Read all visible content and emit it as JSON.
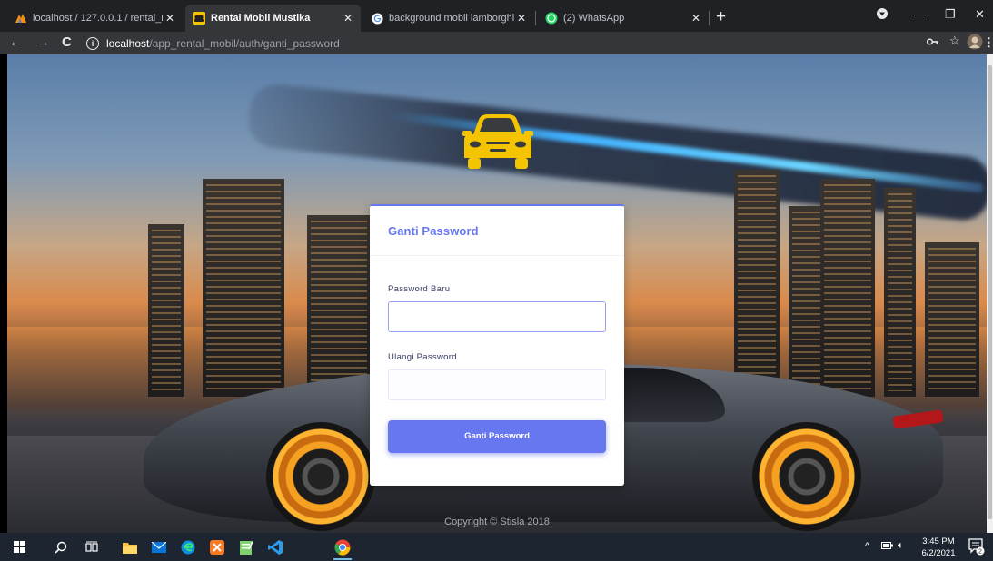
{
  "browser": {
    "tabs": [
      {
        "label": "localhost / 127.0.0.1 / rental_mo",
        "icon": "phpmyadmin-icon",
        "active": false
      },
      {
        "label": "Rental Mobil Mustika",
        "icon": "car-favicon-icon",
        "active": true
      },
      {
        "label": "background mobil lamborghini h",
        "icon": "google-icon",
        "active": false
      },
      {
        "label": "(2) WhatsApp",
        "icon": "whatsapp-icon",
        "active": false
      }
    ],
    "url_host": "localhost",
    "url_path": "/app_rental_mobil/auth/ganti_password"
  },
  "page": {
    "card_title": "Ganti Password",
    "fields": [
      {
        "label": "Password Baru",
        "value": ""
      },
      {
        "label": "Ulangi Password",
        "value": ""
      }
    ],
    "submit_label": "Ganti Password",
    "copyright": "Copyright © Stisla 2018"
  },
  "taskbar": {
    "time": "3:45 PM",
    "date": "6/2/2021",
    "notification_count": "2"
  },
  "colors": {
    "primary": "#6777ef",
    "logo_yellow": "#f5c400"
  }
}
